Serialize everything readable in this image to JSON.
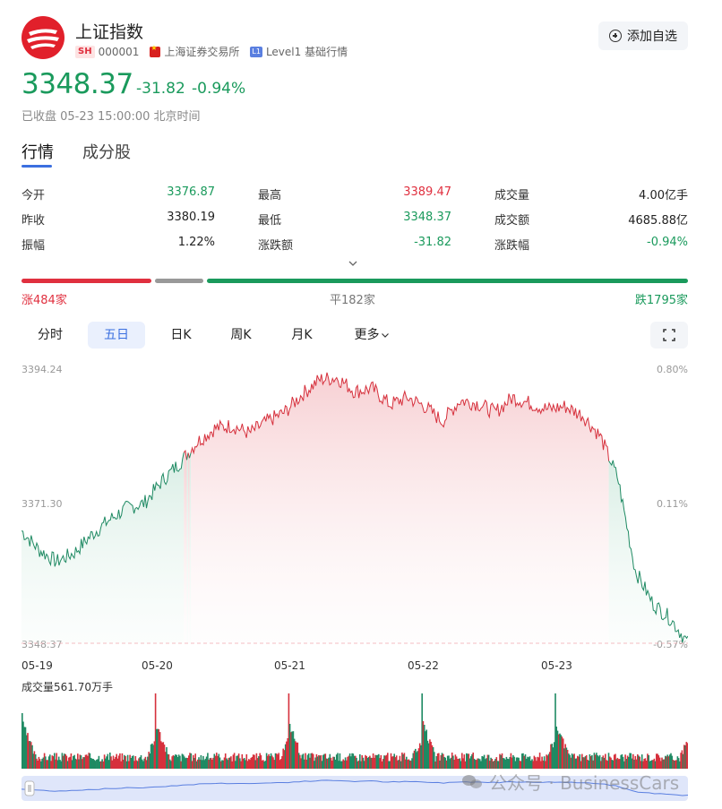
{
  "header": {
    "title": "上证指数",
    "market_badge": "SH",
    "code": "000001",
    "exchange": "上海证券交易所",
    "level_badge": "L1",
    "level": "Level1 基础行情",
    "add_watchlist": "添加自选",
    "price": "3348.37",
    "change": "-31.82",
    "change_pct": "-0.94%",
    "status": "已收盘 05-23 15:00:00 北京时间"
  },
  "tabs": [
    "行情",
    "成分股"
  ],
  "stats": {
    "rows": [
      [
        {
          "label": "今开",
          "value": "3376.87",
          "color": "green"
        },
        {
          "label": "最高",
          "value": "3389.47",
          "color": "red"
        },
        {
          "label": "成交量",
          "value": "4.00亿手",
          "color": "dark"
        }
      ],
      [
        {
          "label": "昨收",
          "value": "3380.19",
          "color": "dark"
        },
        {
          "label": "最低",
          "value": "3348.37",
          "color": "green"
        },
        {
          "label": "成交额",
          "value": "4685.88亿",
          "color": "dark"
        }
      ],
      [
        {
          "label": "振幅",
          "value": "1.22%",
          "color": "dark"
        },
        {
          "label": "涨跌额",
          "value": "-31.82",
          "color": "green"
        },
        {
          "label": "涨跌幅",
          "value": "-0.94%",
          "color": "green"
        }
      ]
    ]
  },
  "breadth": {
    "up_label": "涨484家",
    "flat_label": "平182家",
    "down_label": "跌1795家",
    "up": 484,
    "flat": 182,
    "down": 1795
  },
  "period_tabs": [
    "分时",
    "五日",
    "日K",
    "周K",
    "月K",
    "更多"
  ],
  "active_period": "五日",
  "chart": {
    "y_left": [
      "3394.24",
      "3371.30",
      "3348.37"
    ],
    "y_right": [
      "0.80%",
      "0.11%",
      "-0.57%"
    ],
    "dates": [
      "05-19",
      "05-20",
      "05-21",
      "05-22",
      "05-23"
    ],
    "volume_label": "成交量561.70万手"
  },
  "chart_data": {
    "type": "line",
    "title": "",
    "x": [
      "05-19",
      "05-20",
      "05-21",
      "05-22",
      "05-23"
    ],
    "ylim": [
      3348.37,
      3394.24
    ],
    "prev_close": 3380.19,
    "series": [
      {
        "values": [
          3367.2,
          3364.0,
          3362.0,
          3363.5,
          3366.5,
          3369.0,
          3371.0,
          3371.8,
          3375.5,
          3378.5,
          3382.0,
          3384.3,
          3384.8,
          3383.5,
          3385.5,
          3387.0,
          3390.0,
          3392.5,
          3392.8,
          3390.5,
          3391.0,
          3388.3,
          3389.5,
          3388.0,
          3385.5,
          3389.0,
          3388.5,
          3387.0,
          3389.5,
          3388.5,
          3387.5,
          3388.0,
          3386.5,
          3383.0,
          3376.0,
          3360.5,
          3355.0,
          3352.5,
          3348.4
        ]
      }
    ],
    "volume_peak_day_open": true
  },
  "watermark": "公众号 · BusinessCars"
}
